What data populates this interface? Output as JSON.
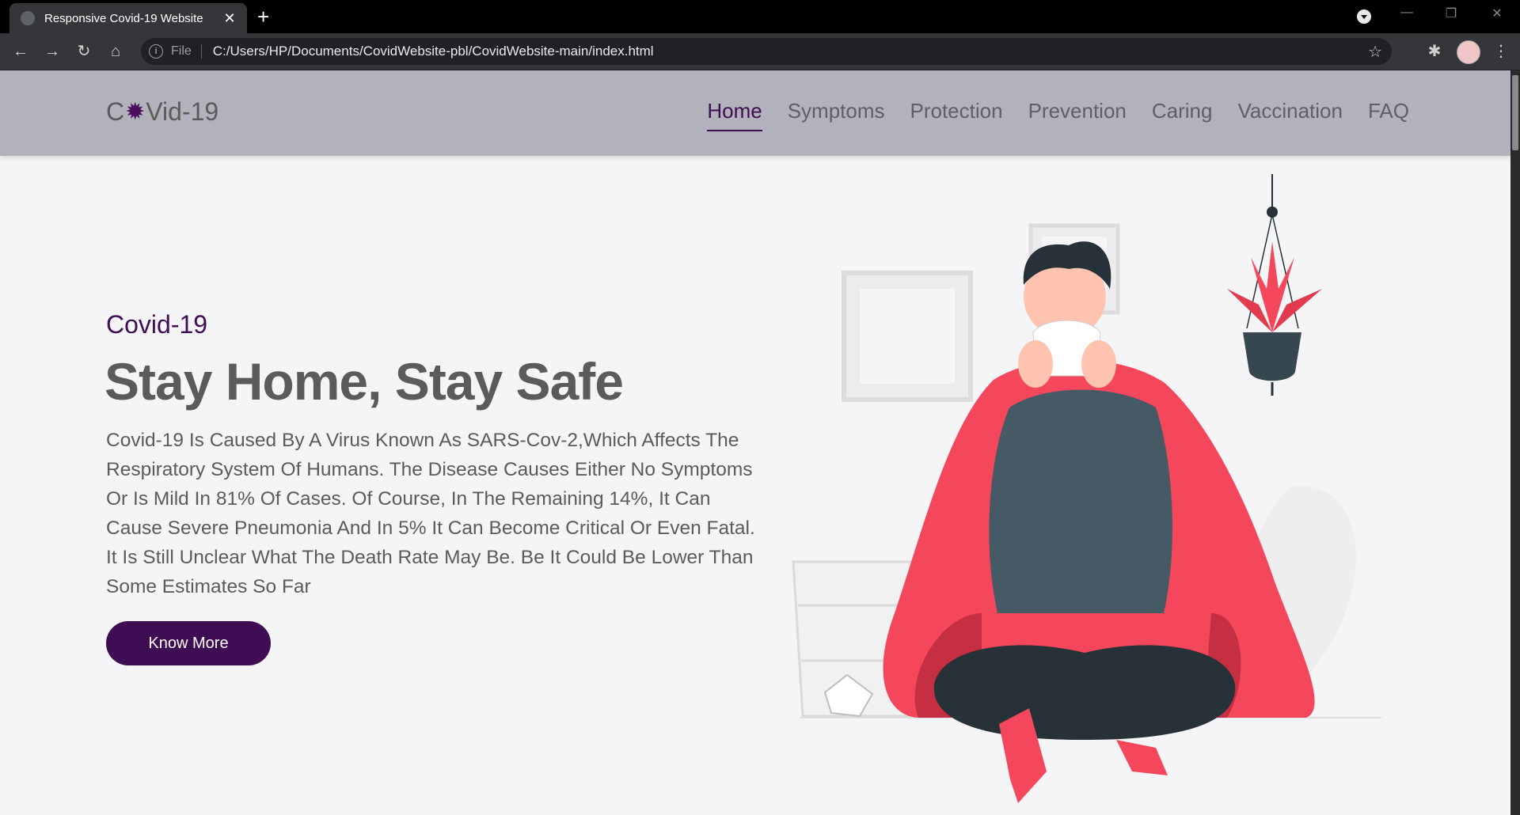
{
  "browser": {
    "tab_title": "Responsive Covid-19 Website",
    "omnibox_label": "File",
    "url": "C:/Users/HP/Documents/CovidWebsite-pbl/CovidWebsite-main/index.html",
    "icons": {
      "back": "arrow-left-icon",
      "forward": "arrow-right-icon",
      "reload": "reload-icon",
      "home": "home-icon",
      "bookmark": "star-icon",
      "extensions": "puzzle-icon",
      "menu": "kebab-menu-icon"
    }
  },
  "site": {
    "logo": {
      "prefix": "C",
      "suffix": "Vid-19"
    },
    "nav": [
      {
        "label": "Home",
        "active": true
      },
      {
        "label": "Symptoms",
        "active": false
      },
      {
        "label": "Protection",
        "active": false
      },
      {
        "label": "Prevention",
        "active": false
      },
      {
        "label": "Caring",
        "active": false
      },
      {
        "label": "Vaccination",
        "active": false
      },
      {
        "label": "FAQ",
        "active": false
      }
    ],
    "hero": {
      "subtitle": "Covid-19",
      "title": "Stay Home, Stay Safe",
      "description": "Covid-19 Is Caused By A Virus Known As SARS-Cov-2,Which Affects The Respiratory System Of Humans. The Disease Causes Either No Symptoms Or Is Mild In 81% Of Cases. Of Course, In The Remaining 14%, It Can Cause Severe Pneumonia And In 5% It Can Become Critical Or Even Fatal. It Is Still Unclear What The Death Rate May Be. Be It Could Be Lower Than Some Estimates So Far",
      "button_label": "Know More"
    },
    "colors": {
      "accent": "#3f0d54",
      "header_bg": "#b3b1bb",
      "illustration_red": "#f5475b",
      "illustration_dark": "#263238"
    }
  }
}
